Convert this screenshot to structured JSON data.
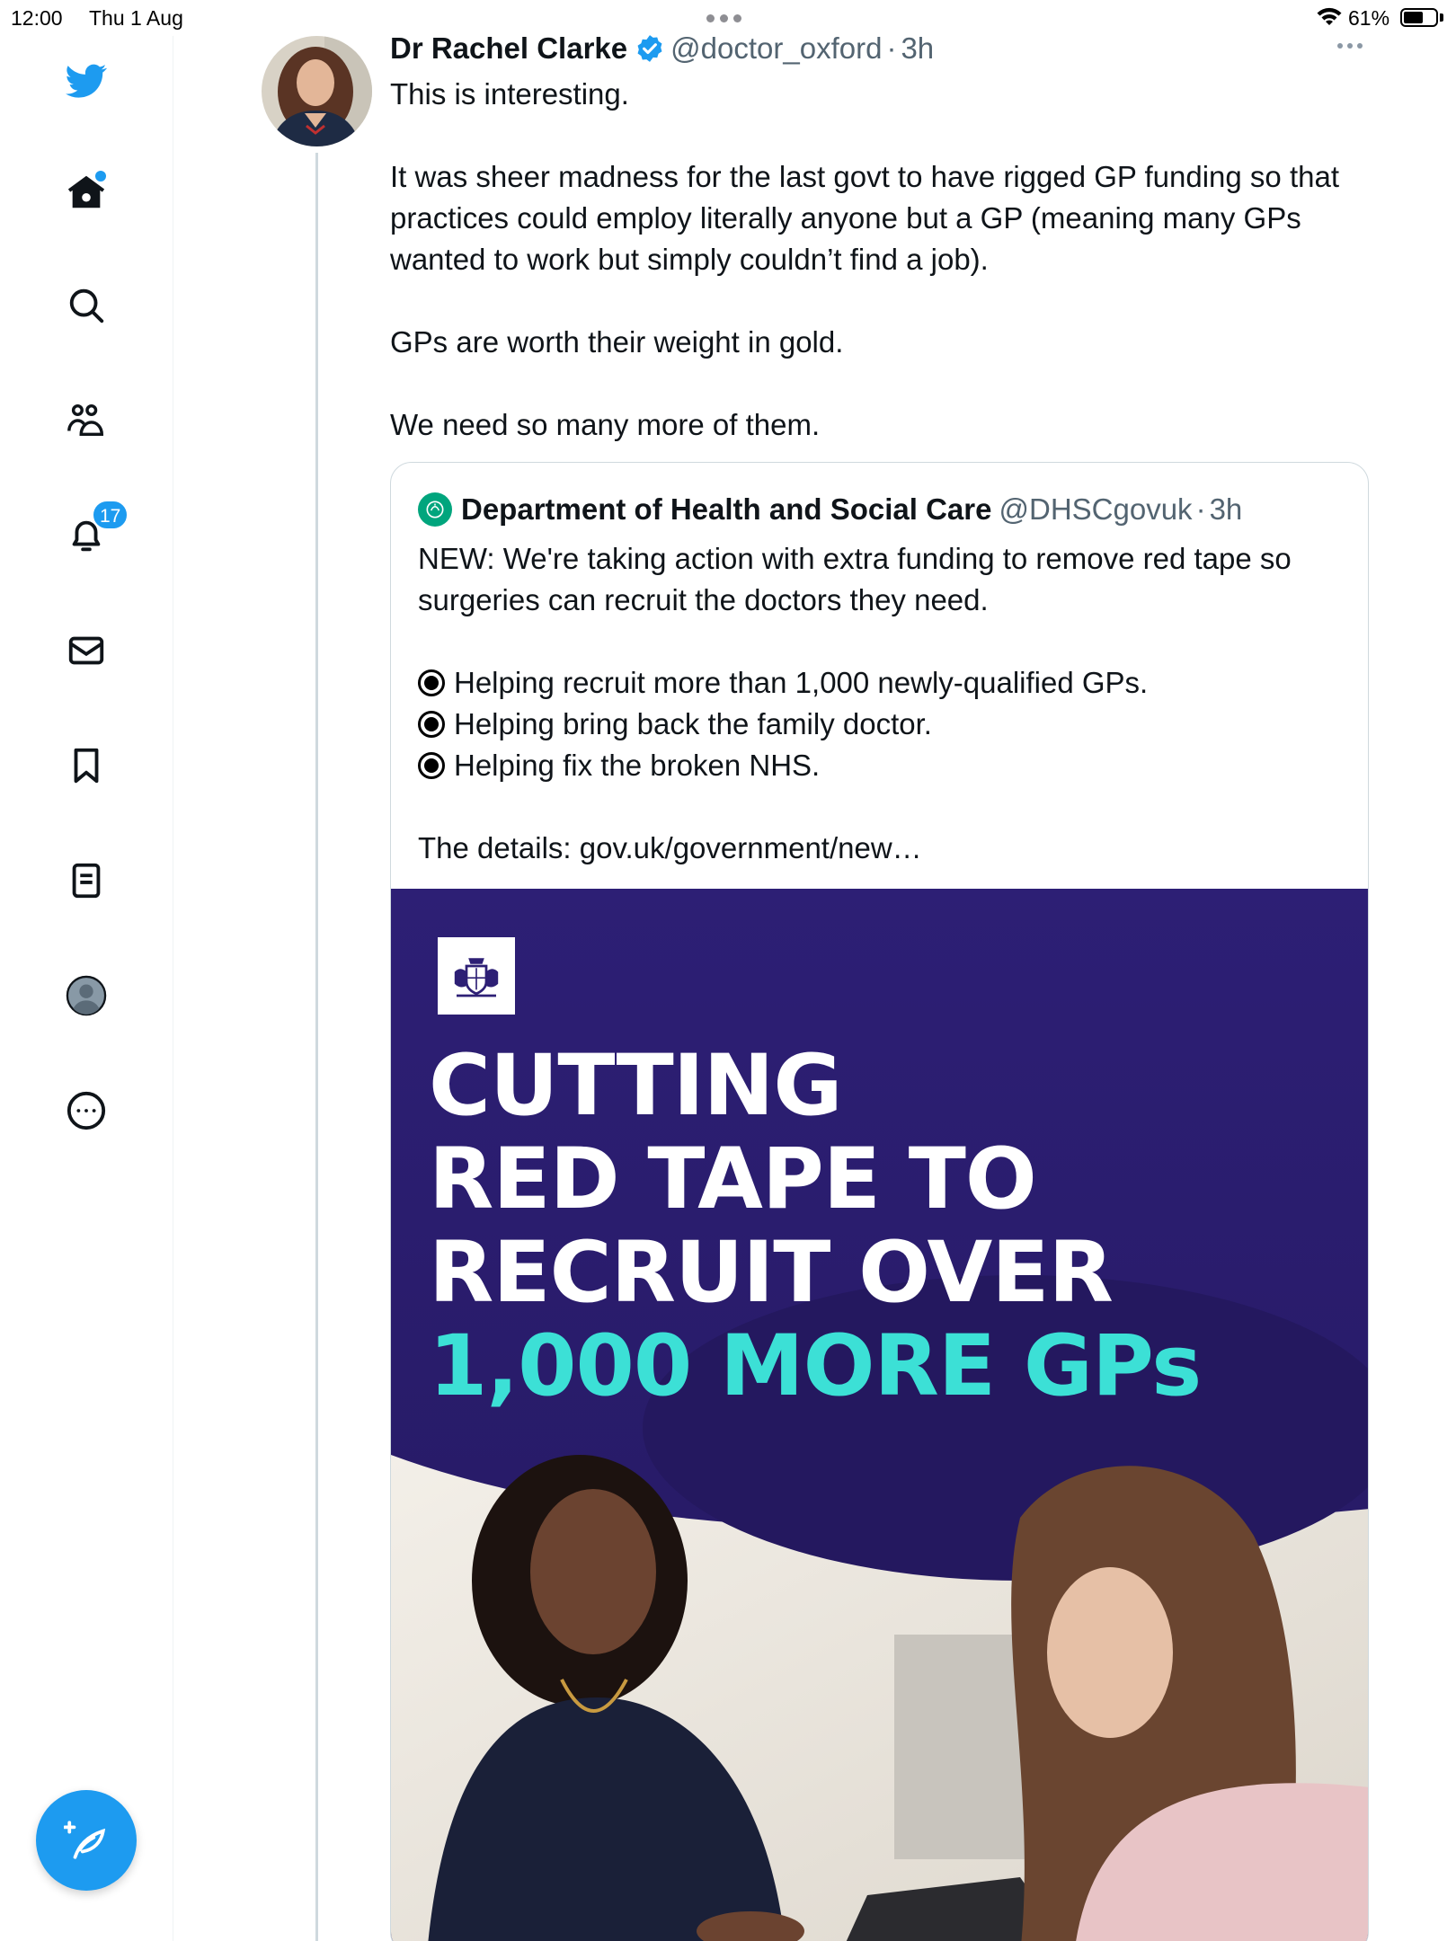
{
  "status_bar": {
    "time": "12:00",
    "date": "Thu 1 Aug",
    "battery_percent": "61%",
    "battery_level": 0.61
  },
  "sidebar": {
    "items": [
      {
        "name": "twitter-logo",
        "icon": "bird-icon"
      },
      {
        "name": "home",
        "icon": "home-icon"
      },
      {
        "name": "explore",
        "icon": "search-icon"
      },
      {
        "name": "communities",
        "icon": "people-icon"
      },
      {
        "name": "notifications",
        "icon": "bell-icon",
        "badge": "17"
      },
      {
        "name": "messages",
        "icon": "envelope-icon"
      },
      {
        "name": "bookmarks",
        "icon": "bookmark-icon"
      },
      {
        "name": "lists",
        "icon": "list-icon"
      },
      {
        "name": "profile",
        "icon": "profile-icon"
      },
      {
        "name": "more",
        "icon": "more-circle-icon"
      }
    ],
    "notifications_badge": "17",
    "compose_icon": "compose-feather-icon"
  },
  "tweet": {
    "author_name": "Dr Rachel Clarke",
    "handle": "@doctor_oxford",
    "separator": "·",
    "time_ago": "3h",
    "paragraphs": [
      "This is interesting.",
      "It was sheer madness for the last govt to have rigged GP funding so that practices could employ literally anyone but a GP (meaning many GPs wanted to work but simply couldn’t find a job).",
      "GPs are worth their weight in gold.",
      "We need so many more of them."
    ]
  },
  "quote": {
    "author_name": "Department of Health and Social Care",
    "handle": "@DHSCgovuk",
    "separator": "·",
    "time_ago": "3h",
    "intro": "NEW: We're taking action with extra funding to remove red tape so surgeries can recruit the doctors they need.",
    "bullets": [
      "Helping recruit more than 1,000 newly-qualified GPs.",
      "Helping bring back the family doctor.",
      "Helping fix the broken NHS."
    ],
    "details": "The details: gov.uk/government/new…",
    "media": {
      "headline_lines": [
        "CUTTING",
        "RED TAPE TO",
        "RECRUIT OVER"
      ],
      "headline_accent": "1,000 MORE GPs"
    }
  },
  "colors": {
    "accent": "#1d9bf0",
    "media_bg": "#2a1c6e",
    "headline_accent": "#3ce0d6",
    "dhsc_green": "#00a57d"
  }
}
